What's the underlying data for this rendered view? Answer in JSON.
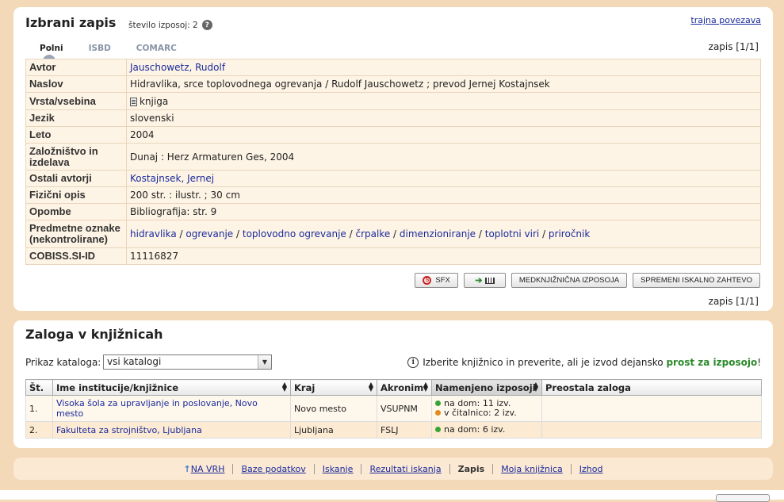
{
  "record": {
    "title": "Izbrani zapis",
    "borrow_count_label": "število izposoj: 2",
    "help_glyph": "?",
    "permalink": "trajna povezava",
    "tabs": [
      {
        "label": "Polni",
        "active": true
      },
      {
        "label": "ISBD",
        "active": false
      },
      {
        "label": "COMARC",
        "active": false
      }
    ],
    "counter": "zapis [1/1]",
    "fields": {
      "author": {
        "label": "Avtor",
        "value": "Jauschowetz, Rudolf"
      },
      "title": {
        "label": "Naslov",
        "value": "Hidravlika, srce toplovodnega ogrevanja / Rudolf Jauschowetz ; prevod Jernej Kostajnsek"
      },
      "type": {
        "label": "Vrsta/vsebina",
        "value": "knjiga"
      },
      "language": {
        "label": "Jezik",
        "value": "slovenski"
      },
      "year": {
        "label": "Leto",
        "value": "2004"
      },
      "publisher": {
        "label": "Založništvo in izdelava",
        "value": "Dunaj : Herz Armaturen Ges, 2004"
      },
      "other_authors": {
        "label": "Ostali avtorji",
        "value": "Kostajnsek, Jernej"
      },
      "physical": {
        "label": "Fizični opis",
        "value": "200 str. : ilustr. ; 30 cm"
      },
      "notes": {
        "label": "Opombe",
        "value": "Bibliografija: str. 9"
      },
      "subjects": {
        "label": "Predmetne oznake (nekontrolirane)",
        "items": [
          "hidravlika",
          "ogrevanje",
          "toplovodno ogrevanje",
          "črpalke",
          "dimenzioniranje",
          "toplotni viri",
          "priročnik"
        ],
        "separator": " / "
      },
      "cobiss_id": {
        "label": "COBISS.SI-ID",
        "value": "11116827"
      }
    },
    "buttons": {
      "sfx": "SFX",
      "interlibrary": "MEDKNJIŽNIČNA IZPOSOJA",
      "change_search": "SPREMENI ISKALNO ZAHTEVO"
    }
  },
  "holdings": {
    "title": "Zaloga v knjižnicah",
    "catalog_label": "Prikaz kataloga:",
    "catalog_value": "vsi katalogi",
    "info_prefix": "Izberite knjižnico in preverite, ali je izvod dejansko",
    "info_highlight": "prost za izposojo",
    "info_suffix": "!",
    "columns": [
      "Št.",
      "Ime institucije/knjižnice",
      "Kraj",
      "Akronim",
      "Namenjeno izposoji",
      "Preostala zaloga"
    ],
    "rows": [
      {
        "num": "1.",
        "name": "Visoka šola za upravljanje in poslovanje, Novo mesto",
        "city": "Novo mesto",
        "acronym": "VSUPNM",
        "loan": [
          {
            "status": "green",
            "text": "na dom: 11 izv."
          },
          {
            "status": "orange",
            "text": "v čitalnico: 2 izv."
          }
        ],
        "remaining": ""
      },
      {
        "num": "2.",
        "name": "Fakulteta za strojništvo, Ljubljana",
        "city": "Ljubljana",
        "acronym": "FSLJ",
        "loan": [
          {
            "status": "green",
            "text": "na dom: 6 izv."
          }
        ],
        "remaining": ""
      }
    ]
  },
  "footer": {
    "links": [
      "NA VRH",
      "Baze podatkov",
      "Iskanje",
      "Rezultati iskanja",
      "Zapis",
      "Moja knjižnica",
      "Izhod"
    ],
    "current": "Zapis"
  },
  "colors": {
    "page_bg": "#f3d9b7",
    "link": "#1a2a9c",
    "available_highlight": "#2c8a2c",
    "status_green": "#39a335",
    "status_orange": "#e28a1b"
  }
}
